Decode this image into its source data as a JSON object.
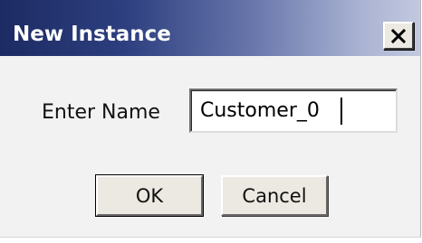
{
  "window": {
    "title": "New Instance",
    "close_icon": "close-icon"
  },
  "form": {
    "name_label": "Enter Name",
    "name_value": "Customer_0"
  },
  "buttons": {
    "ok_label": "OK",
    "cancel_label": "Cancel"
  },
  "colors": {
    "titlebar_start": "#1d2b63",
    "titlebar_end": "#c2c8df",
    "dialog_background": "#f2f2f2",
    "button_face": "#ece9e2"
  }
}
